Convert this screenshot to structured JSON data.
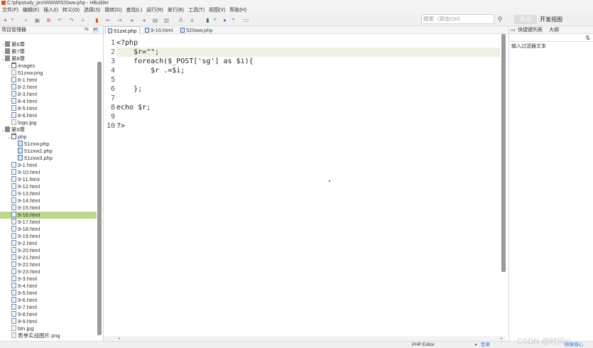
{
  "window": {
    "title": "C:\\phpstudy_pro\\WWW\\520ww.php  -  HBuilder"
  },
  "menu": [
    "文件(F)",
    "编辑(E)",
    "插入(I)",
    "转义(O)",
    "选择(S)",
    "跳转(G)",
    "查找(L)",
    "运行(R)",
    "发行(B)",
    "工具(T)",
    "视图(V)",
    "帮助(H)"
  ],
  "toolbar": {
    "search_placeholder": "搜索（双击Ctrl）",
    "read_label": "阅 读",
    "dev_view_label": "开发视图"
  },
  "project_manager": {
    "title": "项目管理器",
    "tree": [
      {
        "label": "第6章",
        "kind": "project",
        "depth": 0,
        "arrow": "›"
      },
      {
        "label": "第7章",
        "kind": "project",
        "depth": 0,
        "arrow": "›"
      },
      {
        "label": "第8章",
        "kind": "project",
        "depth": 0,
        "arrow": "⌄"
      },
      {
        "label": "images",
        "kind": "folder",
        "depth": 1,
        "arrow": "›"
      },
      {
        "label": "51zxw.png",
        "kind": "img",
        "depth": 1,
        "arrow": ""
      },
      {
        "label": "8-1.html",
        "kind": "file",
        "depth": 1,
        "arrow": ""
      },
      {
        "label": "8-2.html",
        "kind": "file",
        "depth": 1,
        "arrow": ""
      },
      {
        "label": "8-3.html",
        "kind": "file",
        "depth": 1,
        "arrow": ""
      },
      {
        "label": "8-4.html",
        "kind": "file",
        "depth": 1,
        "arrow": ""
      },
      {
        "label": "8-5.html",
        "kind": "file",
        "depth": 1,
        "arrow": ""
      },
      {
        "label": "8-6.html",
        "kind": "file",
        "depth": 1,
        "arrow": ""
      },
      {
        "label": "logo.jpg",
        "kind": "img",
        "depth": 1,
        "arrow": ""
      },
      {
        "label": "第9章",
        "kind": "project",
        "depth": 0,
        "arrow": "⌄"
      },
      {
        "label": "php",
        "kind": "folder",
        "depth": 1,
        "arrow": "⌄"
      },
      {
        "label": "51zxw.php",
        "kind": "php",
        "depth": 2,
        "arrow": ""
      },
      {
        "label": "51zxw2.php",
        "kind": "php",
        "depth": 2,
        "arrow": ""
      },
      {
        "label": "51zxw3.php",
        "kind": "php",
        "depth": 2,
        "arrow": ""
      },
      {
        "label": "9-1.html",
        "kind": "file",
        "depth": 1,
        "arrow": ""
      },
      {
        "label": "9-10.html",
        "kind": "file",
        "depth": 1,
        "arrow": ""
      },
      {
        "label": "9-11.html",
        "kind": "file",
        "depth": 1,
        "arrow": ""
      },
      {
        "label": "9-12.html",
        "kind": "file",
        "depth": 1,
        "arrow": ""
      },
      {
        "label": "9-13.html",
        "kind": "file",
        "depth": 1,
        "arrow": ""
      },
      {
        "label": "9-14.html",
        "kind": "file",
        "depth": 1,
        "arrow": ""
      },
      {
        "label": "9-15.html",
        "kind": "file",
        "depth": 1,
        "arrow": ""
      },
      {
        "label": "9-16.html",
        "kind": "file",
        "depth": 1,
        "arrow": "",
        "selected": true
      },
      {
        "label": "9-17.html",
        "kind": "file",
        "depth": 1,
        "arrow": ""
      },
      {
        "label": "9-18.html",
        "kind": "file",
        "depth": 1,
        "arrow": ""
      },
      {
        "label": "9-19.html",
        "kind": "file",
        "depth": 1,
        "arrow": ""
      },
      {
        "label": "9-2.html",
        "kind": "file",
        "depth": 1,
        "arrow": ""
      },
      {
        "label": "9-20.html",
        "kind": "file",
        "depth": 1,
        "arrow": ""
      },
      {
        "label": "9-21.html",
        "kind": "file",
        "depth": 1,
        "arrow": ""
      },
      {
        "label": "9-22.html",
        "kind": "file",
        "depth": 1,
        "arrow": ""
      },
      {
        "label": "9-23.html",
        "kind": "file",
        "depth": 1,
        "arrow": ""
      },
      {
        "label": "9-3.html",
        "kind": "file",
        "depth": 1,
        "arrow": ""
      },
      {
        "label": "9-4.html",
        "kind": "file",
        "depth": 1,
        "arrow": ""
      },
      {
        "label": "9-5.html",
        "kind": "file",
        "depth": 1,
        "arrow": ""
      },
      {
        "label": "9-6.html",
        "kind": "file",
        "depth": 1,
        "arrow": ""
      },
      {
        "label": "9-7.html",
        "kind": "file",
        "depth": 1,
        "arrow": ""
      },
      {
        "label": "9-8.html",
        "kind": "file",
        "depth": 1,
        "arrow": ""
      },
      {
        "label": "9-9.html",
        "kind": "file",
        "depth": 1,
        "arrow": ""
      },
      {
        "label": "btn.jpg",
        "kind": "img",
        "depth": 1,
        "arrow": ""
      },
      {
        "label": "表单实战图片.png",
        "kind": "img",
        "depth": 1,
        "arrow": ""
      }
    ]
  },
  "editor": {
    "tabs": [
      "51zxt.php",
      "9-16.html",
      "520ww.php"
    ],
    "active_tab": 0,
    "current_line": 2,
    "lines": [
      {
        "n": "1",
        "code": "<?php"
      },
      {
        "n": "2",
        "code": "    $r=\"\";"
      },
      {
        "n": "3",
        "code": "    foreach($_POST['sg'] as $i){"
      },
      {
        "n": "4",
        "code": "        $r .=$i;"
      },
      {
        "n": "5",
        "code": ""
      },
      {
        "n": "6",
        "code": "    };"
      },
      {
        "n": "7",
        "code": ""
      },
      {
        "n": "8",
        "code": "echo $r;"
      },
      {
        "n": "9",
        "code": ""
      },
      {
        "n": "10",
        "code": "?>"
      }
    ]
  },
  "right_panel": {
    "tabs": [
      "快捷键列表",
      "大纲"
    ],
    "filter_hint": "输入过滤器文本"
  },
  "status": {
    "mode": "PHP Editor",
    "login": "登录",
    "sync": "随意随心"
  },
  "watermark": "CSDN @时间si"
}
